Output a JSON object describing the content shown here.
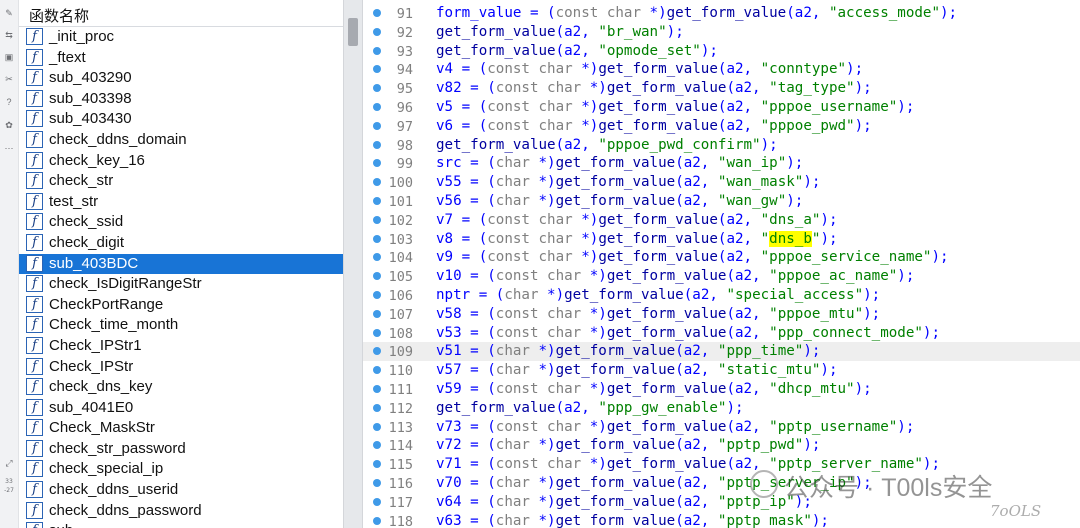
{
  "toolstrip": {
    "icons": [
      "rename-icon",
      "link-icon",
      "graph-icon",
      "scissors-icon",
      "help-icon",
      "bug-icon",
      "more-icon"
    ],
    "expand_icon": "expand-icon",
    "label_a": "33",
    "label_b": "-27"
  },
  "function_panel": {
    "header": "函数名称",
    "icon_glyph": "f",
    "selected": "sub_403BDC",
    "items": [
      "_init_proc",
      "_ftext",
      "sub_403290",
      "sub_403398",
      "sub_403430",
      "check_ddns_domain",
      "check_key_16",
      "check_str",
      "test_str",
      "check_ssid",
      "check_digit",
      "sub_403BDC",
      "check_IsDigitRangeStr",
      "CheckPortRange",
      "Check_time_month",
      "Check_IPStr1",
      "Check_IPStr",
      "check_dns_key",
      "sub_4041E0",
      "Check_MaskStr",
      "check_str_password",
      "check_special_ip",
      "check_ddns_userid",
      "check_ddns_password",
      "sub_"
    ]
  },
  "code": {
    "highlight_line": "109",
    "lines": [
      {
        "n": "91",
        "t": [
          [
            "var",
            "form_value"
          ],
          [
            "plain",
            " = ("
          ],
          [
            "type",
            "const char"
          ],
          [
            "plain",
            " *)"
          ],
          [
            "fn",
            "get_form_value"
          ],
          [
            "plain",
            "(a2, "
          ],
          [
            "str",
            "\"access_mode\""
          ],
          [
            "plain",
            ");"
          ]
        ]
      },
      {
        "n": "92",
        "t": [
          [
            "fn",
            "get_form_value"
          ],
          [
            "plain",
            "(a2, "
          ],
          [
            "str",
            "\"br_wan\""
          ],
          [
            "plain",
            ");"
          ]
        ]
      },
      {
        "n": "93",
        "t": [
          [
            "fn",
            "get_form_value"
          ],
          [
            "plain",
            "(a2, "
          ],
          [
            "str",
            "\"opmode_set\""
          ],
          [
            "plain",
            ");"
          ]
        ]
      },
      {
        "n": "94",
        "t": [
          [
            "var",
            "v4"
          ],
          [
            "plain",
            " = ("
          ],
          [
            "type",
            "const char"
          ],
          [
            "plain",
            " *)"
          ],
          [
            "fn",
            "get_form_value"
          ],
          [
            "plain",
            "(a2, "
          ],
          [
            "str",
            "\"conntype\""
          ],
          [
            "plain",
            ");"
          ]
        ]
      },
      {
        "n": "95",
        "t": [
          [
            "var",
            "v82"
          ],
          [
            "plain",
            " = ("
          ],
          [
            "type",
            "const char"
          ],
          [
            "plain",
            " *)"
          ],
          [
            "fn",
            "get_form_value"
          ],
          [
            "plain",
            "(a2, "
          ],
          [
            "str",
            "\"tag_type\""
          ],
          [
            "plain",
            ");"
          ]
        ]
      },
      {
        "n": "96",
        "t": [
          [
            "var",
            "v5"
          ],
          [
            "plain",
            " = ("
          ],
          [
            "type",
            "const char"
          ],
          [
            "plain",
            " *)"
          ],
          [
            "fn",
            "get_form_value"
          ],
          [
            "plain",
            "(a2, "
          ],
          [
            "str",
            "\"pppoe_username\""
          ],
          [
            "plain",
            ");"
          ]
        ]
      },
      {
        "n": "97",
        "t": [
          [
            "var",
            "v6"
          ],
          [
            "plain",
            " = ("
          ],
          [
            "type",
            "const char"
          ],
          [
            "plain",
            " *)"
          ],
          [
            "fn",
            "get_form_value"
          ],
          [
            "plain",
            "(a2, "
          ],
          [
            "str",
            "\"pppoe_pwd\""
          ],
          [
            "plain",
            ");"
          ]
        ]
      },
      {
        "n": "98",
        "t": [
          [
            "fn",
            "get_form_value"
          ],
          [
            "plain",
            "(a2, "
          ],
          [
            "str",
            "\"pppoe_pwd_confirm\""
          ],
          [
            "plain",
            ");"
          ]
        ]
      },
      {
        "n": "99",
        "t": [
          [
            "var",
            "src"
          ],
          [
            "plain",
            " = ("
          ],
          [
            "type",
            "char"
          ],
          [
            "plain",
            " *)"
          ],
          [
            "fn",
            "get_form_value"
          ],
          [
            "plain",
            "(a2, "
          ],
          [
            "str",
            "\"wan_ip\""
          ],
          [
            "plain",
            ");"
          ]
        ]
      },
      {
        "n": "100",
        "t": [
          [
            "var",
            "v55"
          ],
          [
            "plain",
            " = ("
          ],
          [
            "type",
            "char"
          ],
          [
            "plain",
            " *)"
          ],
          [
            "fn",
            "get_form_value"
          ],
          [
            "plain",
            "(a2, "
          ],
          [
            "str",
            "\"wan_mask\""
          ],
          [
            "plain",
            ");"
          ]
        ]
      },
      {
        "n": "101",
        "t": [
          [
            "var",
            "v56"
          ],
          [
            "plain",
            " = ("
          ],
          [
            "type",
            "char"
          ],
          [
            "plain",
            " *)"
          ],
          [
            "fn",
            "get_form_value"
          ],
          [
            "plain",
            "(a2, "
          ],
          [
            "str",
            "\"wan_gw\""
          ],
          [
            "plain",
            ");"
          ]
        ]
      },
      {
        "n": "102",
        "t": [
          [
            "var",
            "v7"
          ],
          [
            "plain",
            " = ("
          ],
          [
            "type",
            "const char"
          ],
          [
            "plain",
            " *)"
          ],
          [
            "fn",
            "get_form_value"
          ],
          [
            "plain",
            "(a2, "
          ],
          [
            "str",
            "\"dns_a\""
          ],
          [
            "plain",
            ");"
          ]
        ]
      },
      {
        "n": "103",
        "t": [
          [
            "var",
            "v8"
          ],
          [
            "plain",
            " = ("
          ],
          [
            "type",
            "const char"
          ],
          [
            "plain",
            " *)"
          ],
          [
            "fn",
            "get_form_value"
          ],
          [
            "plain",
            "(a2, "
          ],
          [
            "str",
            "\""
          ],
          [
            "strhl",
            "dns_b"
          ],
          [
            "str",
            "\""
          ],
          [
            "plain",
            ");"
          ]
        ]
      },
      {
        "n": "104",
        "t": [
          [
            "var",
            "v9"
          ],
          [
            "plain",
            " = ("
          ],
          [
            "type",
            "const char"
          ],
          [
            "plain",
            " *)"
          ],
          [
            "fn",
            "get_form_value"
          ],
          [
            "plain",
            "(a2, "
          ],
          [
            "str",
            "\"pppoe_service_name\""
          ],
          [
            "plain",
            ");"
          ]
        ]
      },
      {
        "n": "105",
        "t": [
          [
            "var",
            "v10"
          ],
          [
            "plain",
            " = ("
          ],
          [
            "type",
            "const char"
          ],
          [
            "plain",
            " *)"
          ],
          [
            "fn",
            "get_form_value"
          ],
          [
            "plain",
            "(a2, "
          ],
          [
            "str",
            "\"pppoe_ac_name\""
          ],
          [
            "plain",
            ");"
          ]
        ]
      },
      {
        "n": "106",
        "t": [
          [
            "var",
            "nptr"
          ],
          [
            "plain",
            " = ("
          ],
          [
            "type",
            "char"
          ],
          [
            "plain",
            " *)"
          ],
          [
            "fn",
            "get_form_value"
          ],
          [
            "plain",
            "(a2, "
          ],
          [
            "str",
            "\"special_access\""
          ],
          [
            "plain",
            ");"
          ]
        ]
      },
      {
        "n": "107",
        "t": [
          [
            "var",
            "v58"
          ],
          [
            "plain",
            " = ("
          ],
          [
            "type",
            "const char"
          ],
          [
            "plain",
            " *)"
          ],
          [
            "fn",
            "get_form_value"
          ],
          [
            "plain",
            "(a2, "
          ],
          [
            "str",
            "\"pppoe_mtu\""
          ],
          [
            "plain",
            ");"
          ]
        ]
      },
      {
        "n": "108",
        "t": [
          [
            "var",
            "v53"
          ],
          [
            "plain",
            " = ("
          ],
          [
            "type",
            "const char"
          ],
          [
            "plain",
            " *)"
          ],
          [
            "fn",
            "get_form_value"
          ],
          [
            "plain",
            "(a2, "
          ],
          [
            "str",
            "\"ppp_connect_mode\""
          ],
          [
            "plain",
            ");"
          ]
        ]
      },
      {
        "n": "109",
        "t": [
          [
            "var",
            "v51"
          ],
          [
            "plain",
            " = ("
          ],
          [
            "type",
            "char"
          ],
          [
            "plain",
            " *)"
          ],
          [
            "fn",
            "get_form_value"
          ],
          [
            "plain",
            "(a2, "
          ],
          [
            "str",
            "\"ppp_time\""
          ],
          [
            "plain",
            ");"
          ]
        ]
      },
      {
        "n": "110",
        "t": [
          [
            "var",
            "v57"
          ],
          [
            "plain",
            " = ("
          ],
          [
            "type",
            "char"
          ],
          [
            "plain",
            " *)"
          ],
          [
            "fn",
            "get_form_value"
          ],
          [
            "plain",
            "(a2, "
          ],
          [
            "str",
            "\"static_mtu\""
          ],
          [
            "plain",
            ");"
          ]
        ]
      },
      {
        "n": "111",
        "t": [
          [
            "var",
            "v59"
          ],
          [
            "plain",
            " = ("
          ],
          [
            "type",
            "const char"
          ],
          [
            "plain",
            " *)"
          ],
          [
            "fn",
            "get_form_value"
          ],
          [
            "plain",
            "(a2, "
          ],
          [
            "str",
            "\"dhcp_mtu\""
          ],
          [
            "plain",
            ");"
          ]
        ]
      },
      {
        "n": "112",
        "t": [
          [
            "fn",
            "get_form_value"
          ],
          [
            "plain",
            "(a2, "
          ],
          [
            "str",
            "\"ppp_gw_enable\""
          ],
          [
            "plain",
            ");"
          ]
        ]
      },
      {
        "n": "113",
        "t": [
          [
            "var",
            "v73"
          ],
          [
            "plain",
            " = ("
          ],
          [
            "type",
            "const char"
          ],
          [
            "plain",
            " *)"
          ],
          [
            "fn",
            "get_form_value"
          ],
          [
            "plain",
            "(a2, "
          ],
          [
            "str",
            "\"pptp_username\""
          ],
          [
            "plain",
            ");"
          ]
        ]
      },
      {
        "n": "114",
        "t": [
          [
            "var",
            "v72"
          ],
          [
            "plain",
            " = ("
          ],
          [
            "type",
            "char"
          ],
          [
            "plain",
            " *)"
          ],
          [
            "fn",
            "get_form_value"
          ],
          [
            "plain",
            "(a2, "
          ],
          [
            "str",
            "\"pptp_pwd\""
          ],
          [
            "plain",
            ");"
          ]
        ]
      },
      {
        "n": "115",
        "t": [
          [
            "var",
            "v71"
          ],
          [
            "plain",
            " = ("
          ],
          [
            "type",
            "const char"
          ],
          [
            "plain",
            " *)"
          ],
          [
            "fn",
            "get_form_value"
          ],
          [
            "plain",
            "(a2, "
          ],
          [
            "str",
            "\"pptp_server_name\""
          ],
          [
            "plain",
            ");"
          ]
        ]
      },
      {
        "n": "116",
        "t": [
          [
            "var",
            "v70"
          ],
          [
            "plain",
            " = ("
          ],
          [
            "type",
            "char"
          ],
          [
            "plain",
            " *)"
          ],
          [
            "fn",
            "get_form_value"
          ],
          [
            "plain",
            "(a2, "
          ],
          [
            "str",
            "\"pptp_server_ip\""
          ],
          [
            "plain",
            ");"
          ]
        ]
      },
      {
        "n": "117",
        "t": [
          [
            "var",
            "v64"
          ],
          [
            "plain",
            " = ("
          ],
          [
            "type",
            "char"
          ],
          [
            "plain",
            " *)"
          ],
          [
            "fn",
            "get_form_value"
          ],
          [
            "plain",
            "(a2, "
          ],
          [
            "str",
            "\"pptp_ip\""
          ],
          [
            "plain",
            ");"
          ]
        ]
      },
      {
        "n": "118",
        "t": [
          [
            "var",
            "v63"
          ],
          [
            "plain",
            " = ("
          ],
          [
            "type",
            "char"
          ],
          [
            "plain",
            " *)"
          ],
          [
            "fn",
            "get_form_value"
          ],
          [
            "plain",
            "(a2, "
          ],
          [
            "str",
            "\"pptp_mask\""
          ],
          [
            "plain",
            ");"
          ]
        ]
      }
    ]
  },
  "watermark": {
    "text": "公众号 · T00ls安全",
    "sub": "7oOLS"
  },
  "colors": {
    "selection": "#1874d6",
    "breakpoint_dot": "#3f9ae8",
    "identifier": "#0000ff",
    "string": "#008000",
    "type_keyword": "#808080",
    "search_highlight": "#ffff00"
  }
}
